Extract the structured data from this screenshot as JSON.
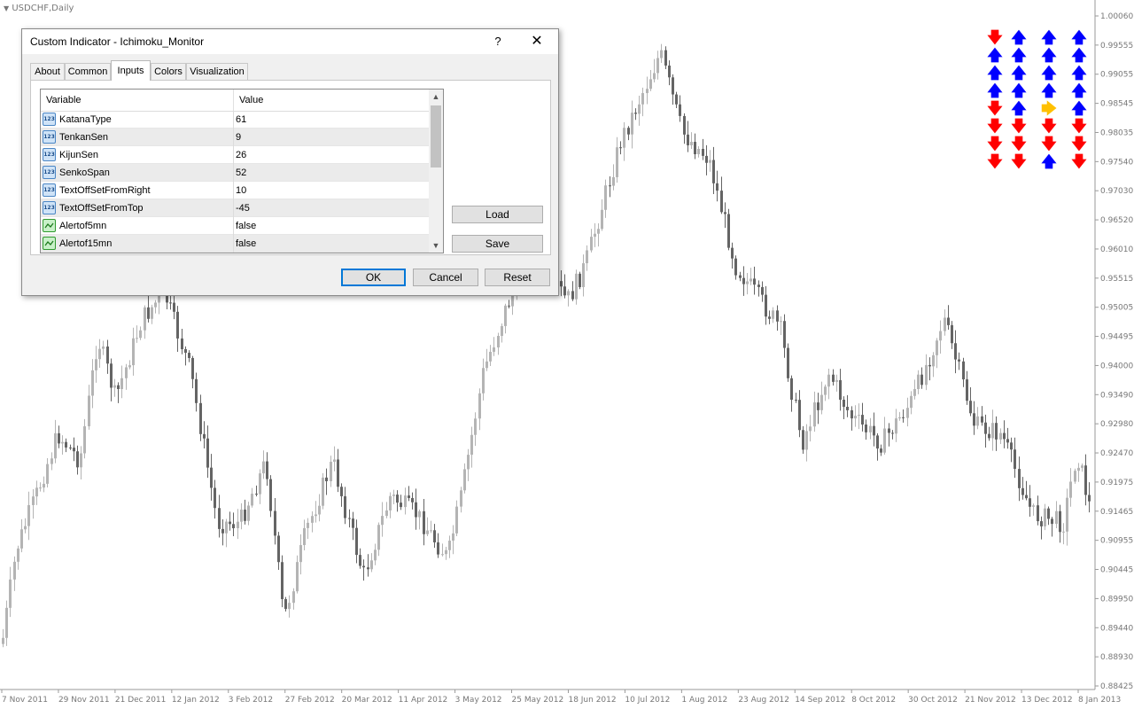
{
  "chart": {
    "title": "USDCHF,Daily",
    "price_labels": [
      "1.00060",
      "0.99555",
      "0.99055",
      "0.98545",
      "0.98035",
      "0.97540",
      "0.97030",
      "0.96520",
      "0.96010",
      "0.95515",
      "0.95005",
      "0.94495",
      "0.94000",
      "0.93490",
      "0.92980",
      "0.92470",
      "0.91975",
      "0.91465",
      "0.90955",
      "0.90445",
      "0.89950",
      "0.89440",
      "0.88930",
      "0.88425"
    ],
    "date_labels": [
      "7 Nov 2011",
      "29 Nov 2011",
      "21 Dec 2011",
      "12 Jan 2012",
      "3 Feb 2012",
      "27 Feb 2012",
      "20 Mar 2012",
      "11 Apr 2012",
      "3 May 2012",
      "25 May 2012",
      "18 Jun 2012",
      "10 Jul 2012",
      "1 Aug 2012",
      "23 Aug 2012",
      "14 Sep 2012",
      "8 Oct 2012",
      "30 Oct 2012",
      "21 Nov 2012",
      "13 Dec 2012",
      "8 Jan 2013"
    ],
    "candle_color_up": "#b4b4b4",
    "candle_color_down": "#646464"
  },
  "signal_grid": {
    "colors": {
      "up": "#0000ff",
      "down": "#ff0000",
      "flat": "#ffc000"
    },
    "glyphs": {
      "up": "🡅",
      "down": "🡇",
      "flat": "🡆"
    },
    "rows": [
      [
        "down",
        "up",
        "up",
        "up"
      ],
      [
        "up",
        "up",
        "up",
        "up"
      ],
      [
        "up",
        "up",
        "up",
        "up"
      ],
      [
        "up",
        "up",
        "up",
        "up"
      ],
      [
        "down",
        "up",
        "flat",
        "up"
      ],
      [
        "down",
        "down",
        "down",
        "down"
      ],
      [
        "down",
        "down",
        "down",
        "down"
      ],
      [
        "down",
        "down",
        "up",
        "down"
      ]
    ]
  },
  "dialog": {
    "title": "Custom Indicator - Ichimoku_Monitor",
    "help": "?",
    "close": "✕",
    "tabs": [
      "About",
      "Common",
      "Inputs",
      "Colors",
      "Visualization"
    ],
    "active_tab": "Inputs",
    "grid": {
      "col_variable": "Variable",
      "col_value": "Value",
      "rows": [
        {
          "type": "num",
          "name": "KatanaType",
          "value": "61"
        },
        {
          "type": "num",
          "name": "TenkanSen",
          "value": "9"
        },
        {
          "type": "num",
          "name": "KijunSen",
          "value": "26"
        },
        {
          "type": "num",
          "name": "SenkoSpan",
          "value": "52"
        },
        {
          "type": "num",
          "name": "TextOffSetFromRight",
          "value": "10"
        },
        {
          "type": "num",
          "name": "TextOffSetFromTop",
          "value": "-45"
        },
        {
          "type": "bool",
          "name": "Alertof5mn",
          "value": "false"
        },
        {
          "type": "bool",
          "name": "Alertof15mn",
          "value": "false"
        }
      ],
      "num_icon_text": "123"
    },
    "buttons": {
      "load": "Load",
      "save": "Save",
      "ok": "OK",
      "cancel": "Cancel",
      "reset": "Reset"
    }
  }
}
